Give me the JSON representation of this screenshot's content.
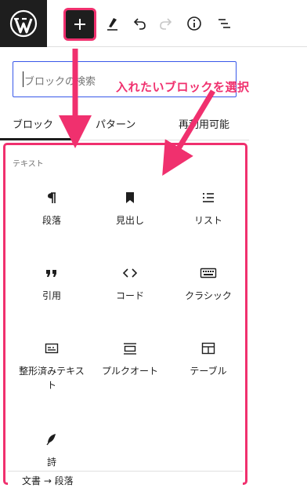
{
  "toolbar": {
    "logo": "wordpress-logo",
    "buttons": [
      {
        "name": "add-block-button",
        "icon": "plus-icon"
      },
      {
        "name": "tools-button",
        "icon": "pencil-icon"
      },
      {
        "name": "undo-button",
        "icon": "undo-icon"
      },
      {
        "name": "redo-button",
        "icon": "redo-icon"
      },
      {
        "name": "details-button",
        "icon": "info-icon"
      },
      {
        "name": "list-view-button",
        "icon": "list-view-icon"
      }
    ]
  },
  "search": {
    "placeholder": "ブロックの検索"
  },
  "tabs": [
    {
      "label": "ブロック",
      "active": true
    },
    {
      "label": "パターン",
      "active": false
    },
    {
      "label": "再利用可能",
      "active": false
    }
  ],
  "category": {
    "label": "テキスト"
  },
  "blocks": [
    {
      "label": "段落",
      "icon": "paragraph-icon"
    },
    {
      "label": "見出し",
      "icon": "bookmark-icon"
    },
    {
      "label": "リスト",
      "icon": "list-icon"
    },
    {
      "label": "引用",
      "icon": "quote-icon"
    },
    {
      "label": "コード",
      "icon": "code-icon"
    },
    {
      "label": "クラシック",
      "icon": "keyboard-icon"
    },
    {
      "label": "整形済みテキスト",
      "icon": "preformatted-icon"
    },
    {
      "label": "プルクオート",
      "icon": "pullquote-icon"
    },
    {
      "label": "テーブル",
      "icon": "table-icon"
    },
    {
      "label": "詩",
      "icon": "feather-icon"
    }
  ],
  "breadcrumb": {
    "text": "文書 → 段落"
  },
  "annotation": {
    "text": "入れたいブロックを選択",
    "color": "#f0306e"
  },
  "colors": {
    "accent": "#f0306e",
    "dark": "#1e1e1e",
    "focus": "#3858e9"
  }
}
